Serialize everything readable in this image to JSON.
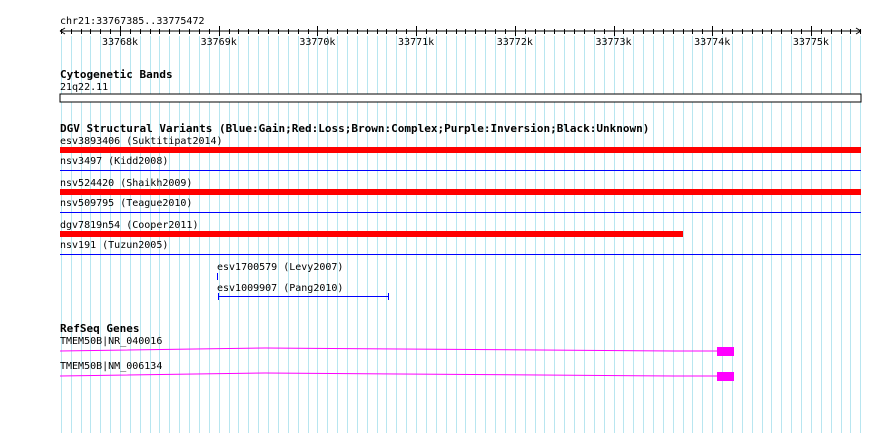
{
  "ruler": {
    "location": "chr21:33767385..33775472",
    "ticks": [
      "33768k",
      "33769k",
      "33770k",
      "33771k",
      "33772k",
      "33773k",
      "33774k",
      "33775k"
    ]
  },
  "cytoband": {
    "title": "Cytogenetic Bands",
    "band": "21q22.11"
  },
  "dgv": {
    "title": "DGV Structural Variants (Blue:Gain;Red:Loss;Brown:Complex;Purple:Inversion;Black:Unknown)",
    "features": [
      {
        "label": "esv3893406 (Suktitipat2014)",
        "color": "#ff0000"
      },
      {
        "label": "nsv3497 (Kidd2008)",
        "color": "#0000ff"
      },
      {
        "label": "nsv524420 (Shaikh2009)",
        "color": "#ff0000"
      },
      {
        "label": "nsv509795 (Teague2010)",
        "color": "#0000ff"
      },
      {
        "label": "dgv7819n54 (Cooper2011)",
        "color": "#ff0000"
      },
      {
        "label": "nsv191 (Tuzun2005)",
        "color": "#0000ff"
      },
      {
        "label": "esv1700579 (Levy2007)",
        "color": "#0000ff"
      },
      {
        "label": "esv1009907 (Pang2010)",
        "color": "#0000ff"
      }
    ]
  },
  "refseq": {
    "title": "RefSeq Genes",
    "genes": [
      {
        "label": "TMEM50B|NR_040016",
        "color": "#ff00ff"
      },
      {
        "label": "TMEM50B|NM_006134",
        "color": "#ff00ff"
      }
    ]
  }
}
